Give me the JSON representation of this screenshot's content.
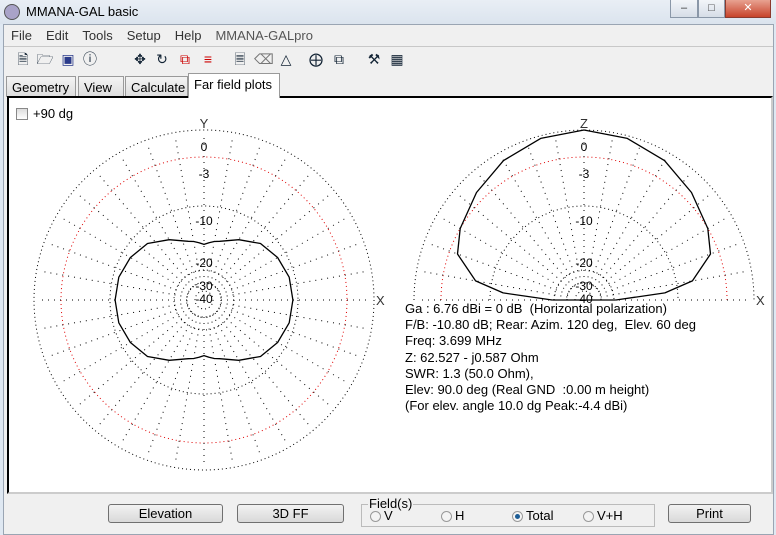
{
  "window": {
    "title": "MMANA-GAL basic",
    "controls": [
      "minimize-icon",
      "maximize-icon",
      "close-icon"
    ]
  },
  "menu": [
    "File",
    "Edit",
    "Tools",
    "Setup",
    "Help",
    "MMANA-GALpro"
  ],
  "toolbar": [
    "new-file-icon",
    "open-folder-icon",
    "save-icon",
    "info-icon",
    "move-icon",
    "rotate-icon",
    "scale-icon",
    "wire-list-icon",
    "document-icon",
    "eraser-icon",
    "triangle-icon",
    "target-icon",
    "copy-icon",
    "tools-icon",
    "calculator-icon"
  ],
  "tabs": [
    {
      "label": "Geometry"
    },
    {
      "label": "View"
    },
    {
      "label": "Calculate"
    },
    {
      "label": "Far field plots",
      "active": true
    }
  ],
  "checkbox": {
    "label": "+90 dg",
    "checked": false
  },
  "colors": {
    "grid": "#000000",
    "ring_3db": "#e00000",
    "pattern": "#000000"
  },
  "chart_data": [
    {
      "type": "polar",
      "plane": "horizontal",
      "axis_labels": {
        "vertical": "Y",
        "horizontal": "X"
      },
      "ring_labels": [
        "0",
        "-3",
        "-10",
        "-20",
        "-30",
        "-40"
      ],
      "angles_deg": [
        0,
        15,
        30,
        45,
        60,
        75,
        80,
        85,
        90,
        95,
        100,
        105,
        120,
        135,
        150,
        165,
        180,
        195,
        210,
        225,
        240,
        255,
        260,
        265,
        270,
        275,
        280,
        285,
        300,
        315,
        330,
        345
      ],
      "gain_db": [
        -10.8,
        -10.9,
        -11.4,
        -12.2,
        -13.8,
        -15.2,
        -15.4,
        -15.7,
        -16.0,
        -15.7,
        -15.4,
        -15.2,
        -13.8,
        -12.2,
        -11.4,
        -10.9,
        -10.8,
        -10.9,
        -11.4,
        -12.2,
        -13.8,
        -15.2,
        -15.4,
        -15.7,
        -16.0,
        -15.7,
        -15.4,
        -15.2,
        -13.8,
        -12.2,
        -11.4,
        -10.9
      ]
    },
    {
      "type": "polar",
      "plane": "vertical",
      "axis_labels": {
        "vertical": "Z",
        "horizontal": "X"
      },
      "ring_labels": [
        "0",
        "-3",
        "-10",
        "-20",
        "-30",
        "-40"
      ],
      "elevation_deg": [
        0,
        5,
        10,
        20,
        30,
        45,
        60,
        75,
        90,
        105,
        120,
        135,
        150,
        160,
        170,
        175,
        180
      ],
      "gain_db": [
        -19.7,
        -12,
        -7.7,
        -4.2,
        -3.0,
        -2.0,
        -1.0,
        -0.3,
        0,
        -0.3,
        -1.0,
        -2.0,
        -3.0,
        -4.2,
        -7.7,
        -12,
        -19.7
      ]
    }
  ],
  "info": {
    "ga": "Ga : 6.76 dBi = 0 dB  (Horizontal polarization)",
    "fb": "F/B: -10.80 dB; Rear: Azim. 120 deg,  Elev. 60 deg",
    "freq": "Freq: 3.699 MHz",
    "z": "Z: 62.527 - j0.587 Ohm",
    "swr": "SWR: 1.3 (50.0 Ohm),",
    "elev": "Elev: 90.0 deg (Real GND  :0.00 m height)",
    "peak": "(For elev. angle 10.0 dg Peak:-4.4 dBi)"
  },
  "buttons": {
    "elevation": "Elevation",
    "ff3d": "3D FF",
    "print": "Print"
  },
  "fields": {
    "label": "Field(s)",
    "options": [
      "V",
      "H",
      "Total",
      "V+H"
    ],
    "selected": "Total"
  }
}
